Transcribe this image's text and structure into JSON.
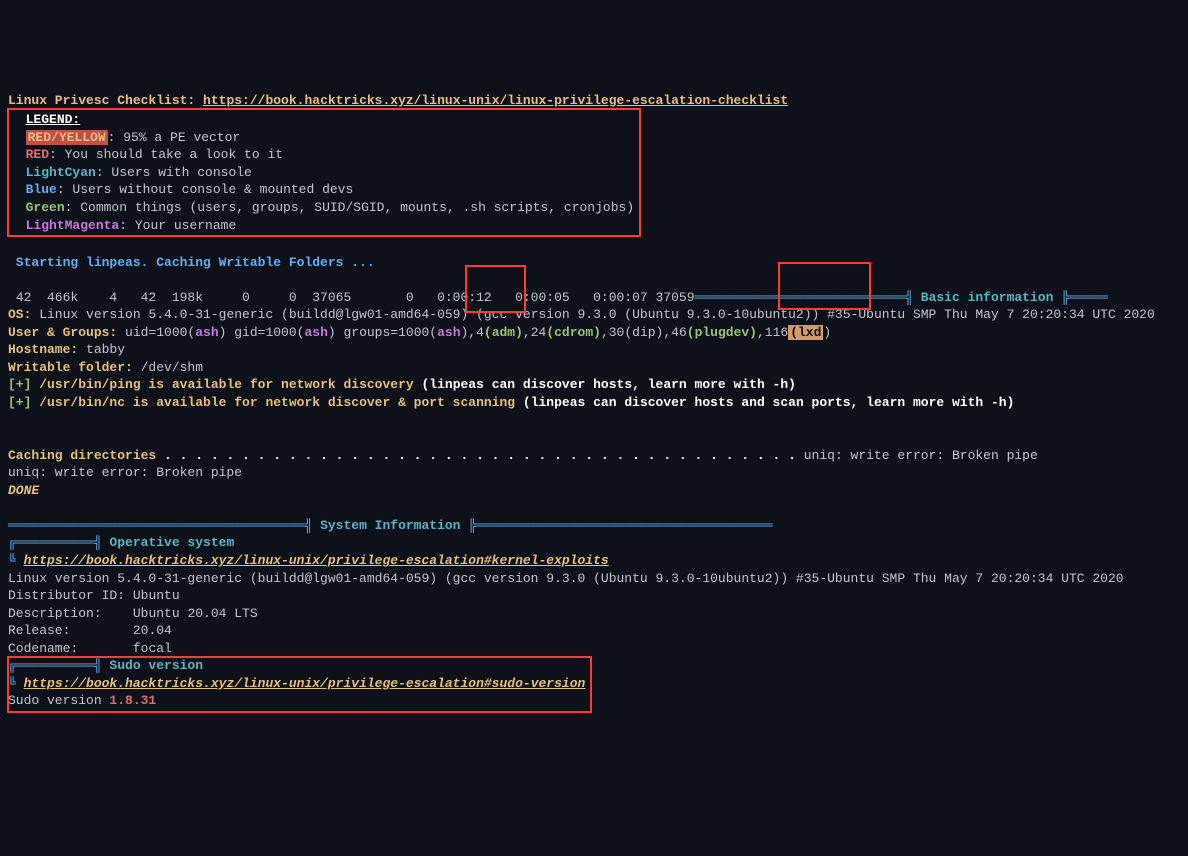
{
  "header": {
    "title_label": "Linux Privesc Checklist:",
    "title_url": "https://book.hacktricks.xyz/linux-unix/linux-privilege-escalation-checklist"
  },
  "legend": {
    "heading": "LEGEND:",
    "rows": [
      {
        "color_label": "RED/YELLOW",
        "css": "redbg",
        "desc": ": 95% a PE vector"
      },
      {
        "color_label": "RED",
        "css": "red",
        "desc": ": You should take a look to it"
      },
      {
        "color_label": "LightCyan",
        "css": "lightcyan",
        "desc": ": Users with console"
      },
      {
        "color_label": "Blue",
        "css": "blue",
        "desc": ": Users without console & mounted devs"
      },
      {
        "color_label": "Green",
        "css": "green",
        "desc": ": Common things (users, groups, SUID/SGID, mounts, .sh scripts, cronjobs)"
      },
      {
        "color_label": "LightMagenta",
        "css": "magenta",
        "desc": ": Your username"
      }
    ]
  },
  "start_line": " Starting linpeas. Caching Writable Folders ...",
  "stats": " 42  466k    4   42  198k     0     0  37065       0   0:00:12   0:00:05   0:00:07 37059",
  "basic": {
    "section_label": "Basic information",
    "os_label": "OS:",
    "os_value": " Linux version 5.4.0-31-generic (buildd@lgw01-amd64-059) (gcc version 9.3.0 (Ubuntu 9.3.0-10ubuntu2)) #35-Ubuntu SMP Thu May 7 20:20:34 UTC 2020",
    "ug_label": "User & Groups:",
    "ug_pre": " uid=1000(",
    "ash1": "ash",
    "ug_mid1": ") gid=1000(",
    "ash2": "ash",
    "ug_mid2": ") groups=1000(",
    "ash3": "ash",
    "ug_mid3": "),4",
    "adm": "(adm)",
    "ug_mid4": ",24",
    "cdrom": "(cdrom)",
    "ug_mid5": ",30(dip),46",
    "plugdev": "(plugdev)",
    "ug_mid6": ",116",
    "lxd": "(lxd",
    "ug_end": ")",
    "hostname_label": "Hostname:",
    "hostname_value": " tabby",
    "writable_label": "Writable folder:",
    "writable_value": " /dev/shm",
    "plus1_a": "[+] ",
    "plus1_b": "/usr/bin/ping is available for network discovery ",
    "plus1_c": "(linpeas can discover hosts, learn more with -h)",
    "plus2_a": "[+] ",
    "plus2_b": "/usr/bin/nc is available for network discover & port scanning ",
    "plus2_c": "(linpeas can discover hosts and scan ports, learn more with -h)"
  },
  "cache": {
    "label": "Caching directories ",
    "dots": ". . . . . . . . . . . . . . . . . . . . . . . . . . . . . . . . . . . . . . . . .",
    "err1": " uniq: write error: Broken pipe",
    "err2": "uniq: write error: Broken pipe",
    "done": "DONE"
  },
  "sysinfo": {
    "heading": "System Information",
    "os_heading": "Operative system",
    "os_url": "https://book.hacktricks.xyz/linux-unix/privilege-escalation#kernel-exploits",
    "os_line": "Linux version 5.4.0-31-generic (buildd@lgw01-amd64-059) (gcc version 9.3.0 (Ubuntu 9.3.0-10ubuntu2)) #35-Ubuntu SMP Thu May 7 20:20:34 UTC 2020",
    "rows": [
      {
        "k": "Distributor ID:",
        "v": "Ubuntu"
      },
      {
        "k": "Description:",
        "v": "   Ubuntu 20.04 LTS"
      },
      {
        "k": "Release:",
        "v": "       20.04"
      },
      {
        "k": "Codename:",
        "v": "      focal"
      }
    ],
    "sudo_heading": "Sudo version",
    "sudo_url": "https://book.hacktricks.xyz/linux-unix/privilege-escalation#sudo-version",
    "sudo_line_a": "Sudo version ",
    "sudo_line_b": "1.8.31"
  },
  "rules": {
    "bar_long": "═══════════════════════════════════════════════════════════════════════════════════════════════════════════════════",
    "bar_med": "════════════════════════════════════",
    "bar_short": "══════════",
    "pipe": "╣",
    "pipe2": "╠",
    "corner_open": "╔══════════╣",
    "dash": "═"
  }
}
